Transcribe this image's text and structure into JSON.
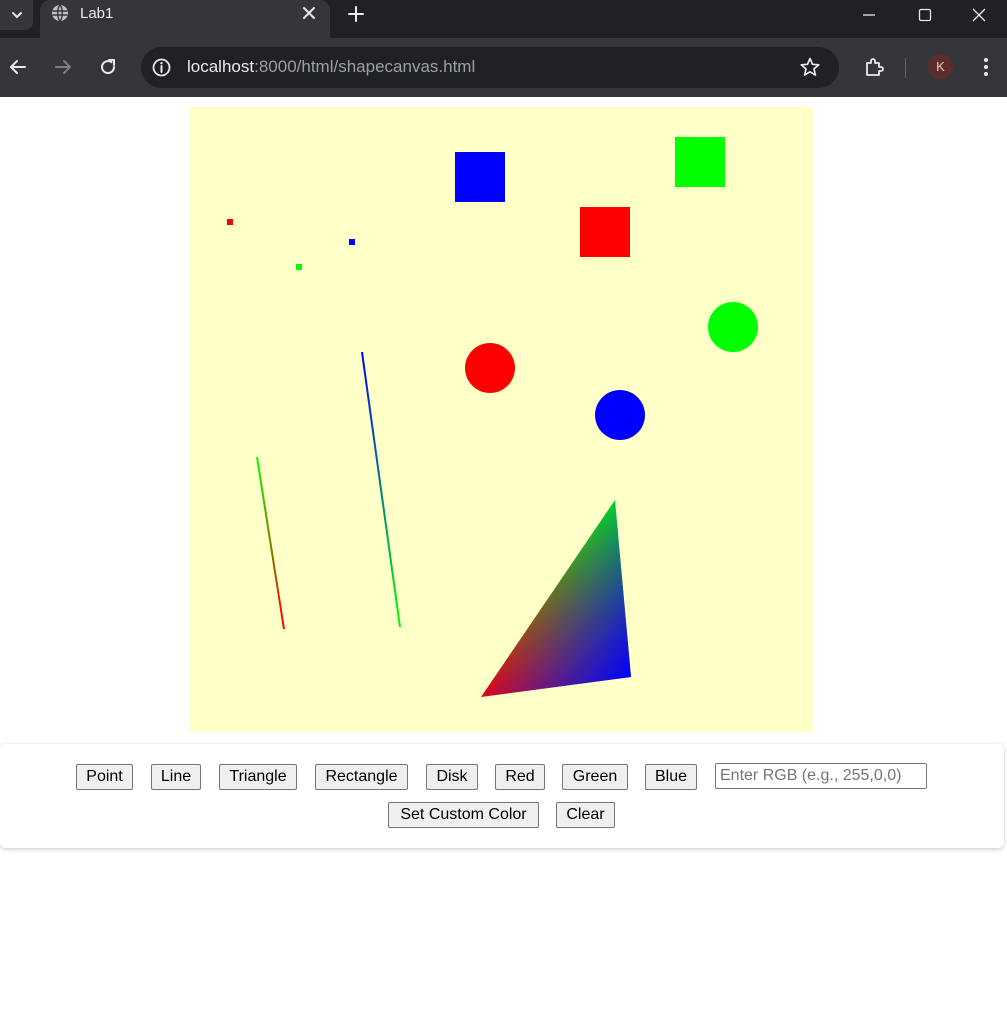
{
  "browser": {
    "tab_title": "Lab1",
    "url_host": "localhost",
    "url_path": ":8000/html/shapecanvas.html",
    "avatar_letter": "K",
    "icons": [
      "tab-search-icon",
      "globe-icon",
      "close-icon",
      "plus-icon",
      "minimize-icon",
      "maximize-icon",
      "window-close-icon",
      "back-arrow-icon",
      "forward-arrow-icon",
      "reload-icon",
      "site-info-icon",
      "star-icon",
      "extensions-icon",
      "more-menu-icon"
    ]
  },
  "canvas": {
    "background": "#ffffc8",
    "colors": {
      "red": "#ff0000",
      "green": "#00ff00",
      "blue": "#0000ff"
    },
    "shapes": [
      {
        "kind": "point",
        "color": "red"
      },
      {
        "kind": "point",
        "color": "green"
      },
      {
        "kind": "point",
        "color": "blue"
      },
      {
        "kind": "line",
        "gradient": [
          "green",
          "red"
        ]
      },
      {
        "kind": "line",
        "gradient": [
          "blue",
          "green"
        ]
      },
      {
        "kind": "triangle",
        "vertex_colors": [
          "red",
          "green",
          "blue"
        ]
      },
      {
        "kind": "rectangle",
        "color": "blue"
      },
      {
        "kind": "rectangle",
        "color": "red"
      },
      {
        "kind": "rectangle",
        "color": "green"
      },
      {
        "kind": "disk",
        "color": "red"
      },
      {
        "kind": "disk",
        "color": "blue"
      },
      {
        "kind": "disk",
        "color": "green"
      }
    ]
  },
  "controls": {
    "point": "Point",
    "line": "Line",
    "triangle": "Triangle",
    "rectangle": "Rectangle",
    "disk": "Disk",
    "red": "Red",
    "green": "Green",
    "blue": "Blue",
    "rgb_placeholder": "Enter RGB (e.g., 255,0,0)",
    "set_custom_color": "Set Custom Color",
    "clear": "Clear"
  }
}
